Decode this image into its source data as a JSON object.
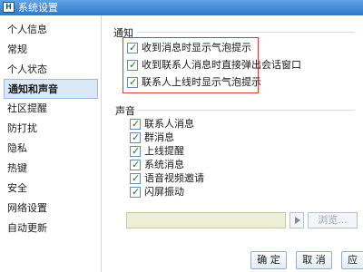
{
  "window": {
    "title": "系统设置",
    "app_icon_text": "H"
  },
  "sidebar": {
    "items": [
      {
        "label": "个人信息",
        "active": false
      },
      {
        "label": "常规",
        "active": false
      },
      {
        "label": "个人状态",
        "active": false
      },
      {
        "label": "通知和声音",
        "active": true
      },
      {
        "label": "社区提醒",
        "active": false
      },
      {
        "label": "防打扰",
        "active": false
      },
      {
        "label": "隐私",
        "active": false
      },
      {
        "label": "热键",
        "active": false
      },
      {
        "label": "安全",
        "active": false
      },
      {
        "label": "网络设置",
        "active": false
      },
      {
        "label": "自动更新",
        "active": false
      }
    ]
  },
  "notify": {
    "title": "通知",
    "options": [
      {
        "label": "收到消息时显示气泡提示",
        "checked": true
      },
      {
        "label": "收到联系人消息时直接弹出会话窗口",
        "checked": true
      },
      {
        "label": "联系人上线时显示气泡提示",
        "checked": true
      }
    ]
  },
  "sound": {
    "title": "声音",
    "options": [
      {
        "label": "联系人消息",
        "checked": true
      },
      {
        "label": "群消息",
        "checked": true
      },
      {
        "label": "上线提醒",
        "checked": true
      },
      {
        "label": "系统消息",
        "checked": true
      },
      {
        "label": "语音视频邀请",
        "checked": true
      },
      {
        "label": "闪屏振动",
        "checked": true
      }
    ],
    "browse_label": "浏览..."
  },
  "buttons": {
    "ok": "确 定",
    "cancel": "取 消",
    "apply": "应"
  }
}
